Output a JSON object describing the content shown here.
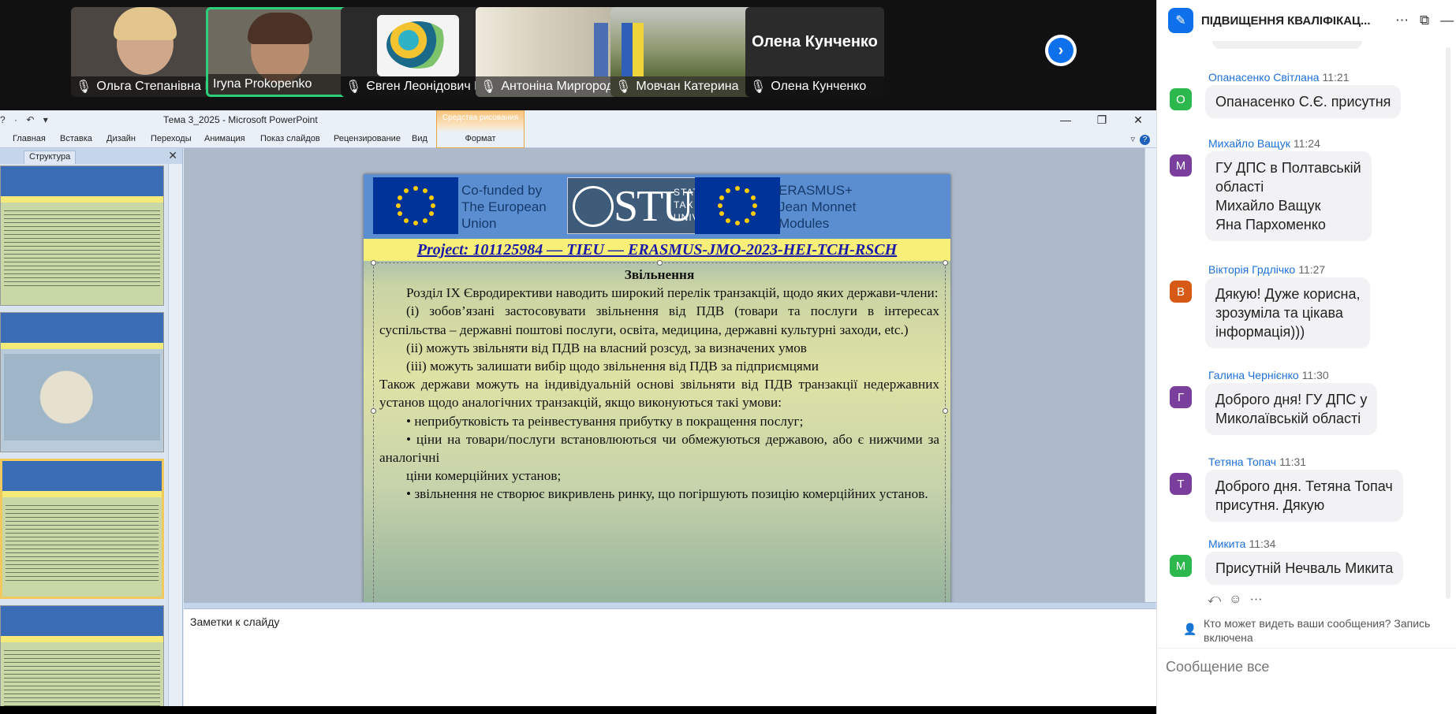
{
  "video_strip": {
    "tiles": [
      {
        "name": "Ольга Степанівна Іван...",
        "muted": true
      },
      {
        "name": "Iryna Prokopenko",
        "muted": false
      },
      {
        "name": "Євген Леонідович Ба...",
        "muted": true
      },
      {
        "name": "Антоніна Миргородсь...",
        "muted": true
      },
      {
        "name": "Мовчан Катерина",
        "muted": true
      },
      {
        "name": "Олена Кунченко",
        "muted": true
      }
    ],
    "big_name": "Олена Кунченко",
    "next_icon": "chevron-right-icon"
  },
  "ppt": {
    "window_title": "Тема 3_2025  -  Microsoft PowerPoint",
    "qat": "? · ↶ ▾",
    "window_controls": [
      "—",
      "❐",
      "✕"
    ],
    "tabs": [
      "Главная",
      "Вставка",
      "Дизайн",
      "Переходы",
      "Анимация",
      "Показ слайдов",
      "Рецензирование",
      "Вид"
    ],
    "context_group": "Средства рисования",
    "context_tab": "Формат",
    "panel_tab": "Структура",
    "panel_close": "✕",
    "slide": {
      "header_left": "Co-funded by\nThe European\nUnion",
      "logo_main": "STU",
      "logo_right": "STATE\nTAX\nUNIVERSITY",
      "header_right": "ERASMUS+\nJean Monnet\nModules",
      "project": "Project: 101125984 — TIEU — ERASMUS-JMO-2023-HEI-TCH-RSCH",
      "heading": "Звільнення",
      "paragraphs": [
        "Розділ IX Євродирективи наводить широкий перелік транзакцій, щодо яких держави-члени:",
        "(і) зобов’язані застосовувати звільнення від ПДВ (товари та послуги в інтересах суспільства – державні поштові послуги, освіта, медицина, державні культурні заходи, etc.)",
        "(іі) можуть звільняти від ПДВ на власний розсуд, за визначених умов",
        "(ііі) можуть залишати вибір щодо звільнення від ПДВ за підприємцями",
        "Також держави можуть на індивідуальній основі звільняти від ПДВ транзакції недержавних установ щодо аналогічних транзакцій, якщо виконуються такі умови:",
        "• неприбутковість та реінвестування прибутку в покращення послуг;",
        "• ціни на товари/послуги встановлюються чи обмежуються державою, або є нижчими за аналогічні",
        "ціни комерційних установ;",
        "• звільнення не створює викривлень ринку, що погіршують позицію комерційних установ."
      ]
    },
    "notes_placeholder": "Заметки к слайду"
  },
  "chat": {
    "title": "ПІДВИЩЕННЯ КВАЛІФІКАЦ...",
    "header_icons": [
      "more-icon",
      "popout-icon",
      "minimize-icon"
    ],
    "messages": [
      {
        "sender": "Опанасенко Світлана",
        "time": "11:21",
        "avatar": "О",
        "avatar_color": "#2db84d",
        "text": "Опанасенко С.Є. присутня"
      },
      {
        "sender": "Михайло Ващук",
        "time": "11:24",
        "avatar": "М",
        "avatar_color": "#7a3f9c",
        "text": "ГУ ДПС в Полтавській\nобласті\nМихайло Ващук\nЯна Пархоменко"
      },
      {
        "sender": "Вікторія Грдлічко",
        "time": "11:27",
        "avatar": "В",
        "avatar_color": "#d65a16",
        "text": "Дякую! Дуже корисна,\nзрозуміла та цікава\nінформація)))"
      },
      {
        "sender": "Галина Чернієнко",
        "time": "11:30",
        "avatar": "Г",
        "avatar_color": "#7a3f9c",
        "text": "Доброго дня! ГУ ДПС у\nМиколаївській області"
      },
      {
        "sender": "Тетяна Топач",
        "time": "11:31",
        "avatar": "Т",
        "avatar_color": "#7a3f9c",
        "text": "Доброго дня. Тетяна Топач\nприсутня. Дякую"
      },
      {
        "sender": "Микита",
        "time": "11:34",
        "avatar": "М",
        "avatar_color": "#2db84d",
        "text": "Присутній Нечваль Микита"
      }
    ],
    "privacy": "Кто может видеть ваши сообщения? Запись включена",
    "input_placeholder": "Сообщение все"
  }
}
